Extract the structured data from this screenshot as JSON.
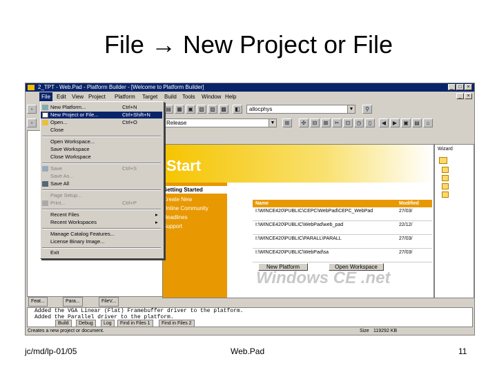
{
  "slide": {
    "title": "File → New Project or File",
    "footer_left": "jc/md/lp-01/05",
    "footer_center": "Web.Pad",
    "footer_right": "11"
  },
  "window": {
    "title": "2_TPT - Web.Pad - Platform Builder - [Welcome to Platform Builder]"
  },
  "menubar": [
    "File",
    "Edit",
    "View",
    "Project",
    "Platform",
    "Target",
    "Build",
    "Tools",
    "Window",
    "Help"
  ],
  "toolbar": {
    "search_value": "allocphys",
    "config_value": "Release"
  },
  "file_menu": {
    "items": [
      {
        "label": "New Platform...",
        "accel": "Ctrl+N",
        "icon": "new-platform-icon"
      },
      {
        "label": "New Project or File...",
        "accel": "Ctrl+Shift+N",
        "icon": "new-file-icon",
        "selected": true
      },
      {
        "label": "Open...",
        "accel": "Ctrl+O",
        "icon": "open-icon"
      },
      {
        "label": "Close",
        "accel": ""
      },
      {
        "label": "Open Workspace...",
        "accel": ""
      },
      {
        "label": "Save Workspace",
        "accel": ""
      },
      {
        "label": "Close Workspace",
        "accel": ""
      },
      {
        "label": "Save",
        "accel": "Ctrl+S",
        "icon": "save-icon"
      },
      {
        "label": "Save As...",
        "accel": ""
      },
      {
        "label": "Save All",
        "accel": "",
        "icon": "save-all-icon"
      },
      {
        "label": "Page Setup...",
        "accel": ""
      },
      {
        "label": "Print...",
        "accel": "Ctrl+P",
        "icon": "print-icon"
      },
      {
        "label": "Recent Files",
        "accel": "▸"
      },
      {
        "label": "Recent Workspaces",
        "accel": "▸"
      },
      {
        "label": "Manage Catalog Features...",
        "accel": ""
      },
      {
        "label": "License Binary Image...",
        "accel": ""
      },
      {
        "label": "Exit",
        "accel": ""
      }
    ]
  },
  "webpad": {
    "banner": "Start",
    "nav": [
      "Getting Started",
      "Create New",
      "Online Community",
      "Headlines",
      "Support"
    ],
    "table": {
      "headers": [
        "Name",
        "Modified"
      ],
      "rows": [
        {
          "name": "I:\\WINCE420\\PUBLIC\\CEPC\\WebPad\\CEPC_WebPad",
          "date": "27/03/"
        },
        {
          "name": "I:\\WINCE420\\PUBLIC\\WebPad\\web_pad",
          "date": "22/12/"
        },
        {
          "name": "I:\\WINCE420\\PUBLIC\\PARALL\\PARALL",
          "date": "27/03/"
        },
        {
          "name": "I:\\WINCE420\\PUBLIC\\WebPad\\sa",
          "date": "27/03/"
        }
      ]
    },
    "buttons": [
      "New Platform",
      "Open Workspace"
    ],
    "logo": "Windows CE .net"
  },
  "bottom_tabs": [
    "Feat...",
    "Para...",
    "FileV..."
  ],
  "output": {
    "lines": [
      "Added the VGA Linear (Flat) Framebuffer driver to the platform.",
      "Added the Parallel driver to the platform."
    ],
    "tabs": [
      "Build",
      "Debug",
      "Log",
      "Find in Files 1",
      "Find in Files 2"
    ]
  },
  "status": {
    "text": "Creates a new project or document.",
    "size": "Size",
    "size_value": "119292 KB"
  },
  "right_pane": {
    "title": "Wizard"
  }
}
